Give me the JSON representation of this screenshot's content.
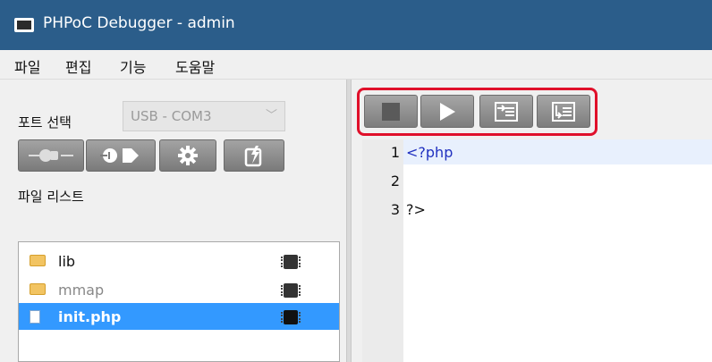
{
  "window": {
    "title": "PHPoC Debugger - admin"
  },
  "menu": [
    "파일",
    "편집",
    "기능",
    "도움말"
  ],
  "sidebar": {
    "port_label": "포트 선택",
    "port_value": "USB - COM3",
    "file_list_label": "파일 리스트",
    "files": [
      {
        "name": "lib",
        "type": "folder",
        "color": "#111111"
      },
      {
        "name": "mmap",
        "type": "folder",
        "color": "#888888"
      },
      {
        "name": "init.php",
        "type": "file",
        "selected": true
      }
    ]
  },
  "editor": {
    "lines": [
      {
        "num": "1",
        "text": "<?php",
        "color": "#2030c0"
      },
      {
        "num": "2",
        "text": "",
        "color": "#111111"
      },
      {
        "num": "3",
        "text": "?>",
        "color": "#111111"
      }
    ]
  },
  "colors": {
    "titlebar": "#2b5d8a",
    "selection": "#3399ff",
    "highlight": "#e0102a"
  }
}
